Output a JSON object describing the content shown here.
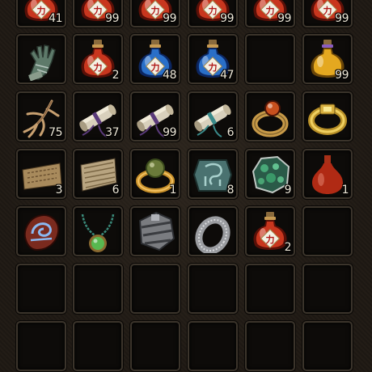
{
  "inventory": {
    "rows": [
      [
        {
          "item": "red-power-potion-icon",
          "count": "41"
        },
        {
          "item": "red-power-potion-icon",
          "count": "99"
        },
        {
          "item": "red-power-potion-icon",
          "count": "99"
        },
        {
          "item": "red-power-potion-icon",
          "count": "99"
        },
        {
          "item": "red-power-potion-icon",
          "count": "99"
        },
        {
          "item": "red-power-potion-icon",
          "count": "99"
        }
      ],
      [
        {
          "item": "gauntlet-icon",
          "count": ""
        },
        {
          "item": "red-power-potion-icon",
          "count": "2"
        },
        {
          "item": "blue-power-potion-icon",
          "count": "48"
        },
        {
          "item": "blue-power-potion-icon",
          "count": "47"
        },
        {
          "item": "",
          "count": ""
        },
        {
          "item": "yellow-potion-icon",
          "count": "99"
        }
      ],
      [
        {
          "item": "root-herb-icon",
          "count": "75"
        },
        {
          "item": "purple-scroll-icon",
          "count": "37"
        },
        {
          "item": "purple-scroll-icon",
          "count": "99"
        },
        {
          "item": "teal-scroll-icon",
          "count": "6"
        },
        {
          "item": "ruby-ring-icon",
          "count": ""
        },
        {
          "item": "gold-ring-icon",
          "count": ""
        }
      ],
      [
        {
          "item": "old-map-icon",
          "count": "3"
        },
        {
          "item": "parchment-roll-icon",
          "count": "6"
        },
        {
          "item": "orb-ring-icon",
          "count": "1"
        },
        {
          "item": "jade-stone-icon",
          "count": "8"
        },
        {
          "item": "jade-ore-icon",
          "count": "9"
        },
        {
          "item": "red-flask-icon",
          "count": "1"
        }
      ],
      [
        {
          "item": "rune-stone-icon",
          "count": ""
        },
        {
          "item": "green-amulet-icon",
          "count": ""
        },
        {
          "item": "iron-bracer-icon",
          "count": ""
        },
        {
          "item": "silver-ring-icon",
          "count": ""
        },
        {
          "item": "red-power-potion-icon",
          "count": "2"
        },
        {
          "item": "",
          "count": ""
        }
      ],
      [
        {
          "item": "",
          "count": ""
        },
        {
          "item": "",
          "count": ""
        },
        {
          "item": "",
          "count": ""
        },
        {
          "item": "",
          "count": ""
        },
        {
          "item": "",
          "count": ""
        },
        {
          "item": "",
          "count": ""
        }
      ],
      [
        {
          "item": "",
          "count": ""
        },
        {
          "item": "",
          "count": ""
        },
        {
          "item": "",
          "count": ""
        },
        {
          "item": "",
          "count": ""
        },
        {
          "item": "",
          "count": ""
        },
        {
          "item": "",
          "count": ""
        }
      ]
    ],
    "potion_glyph": "力"
  }
}
